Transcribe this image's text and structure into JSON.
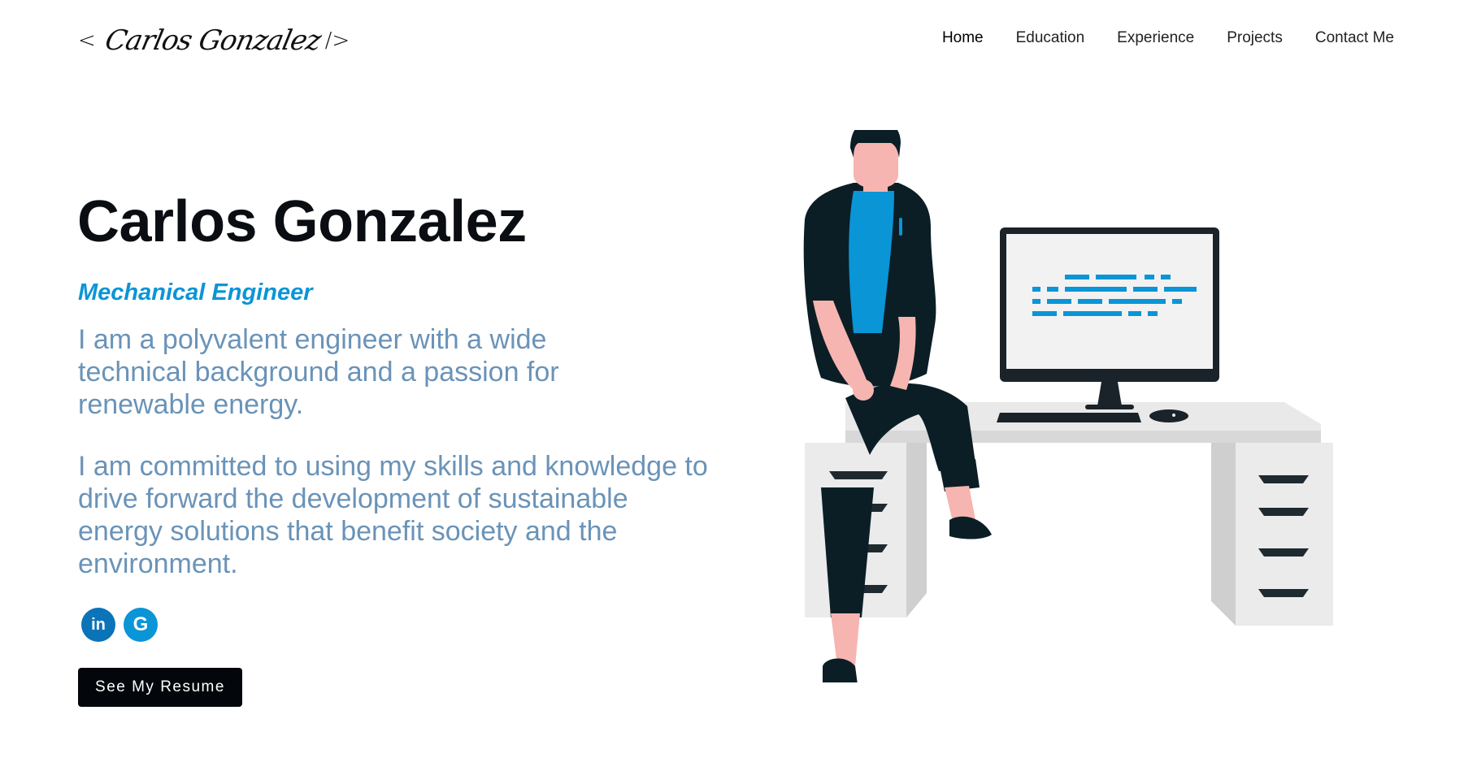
{
  "header": {
    "logo": {
      "open": "<",
      "signature": "Carlos Gonzalez",
      "close": "/>"
    },
    "nav": [
      {
        "label": "Home",
        "active": true
      },
      {
        "label": "Education",
        "active": false
      },
      {
        "label": "Experience",
        "active": false
      },
      {
        "label": "Projects",
        "active": false
      },
      {
        "label": "Contact Me",
        "active": false
      }
    ]
  },
  "hero": {
    "name": "Carlos Gonzalez",
    "role": "Mechanical Engineer",
    "paragraph1": "I am a polyvalent engineer with a wide technical background and a passion for renewable energy.",
    "paragraph2": "I am committed to using my skills and knowledge to drive forward the development of sustainable energy solutions that benefit society and the environment.",
    "socials": [
      {
        "label": "in",
        "icon": "linkedin-icon"
      },
      {
        "label": "G",
        "icon": "google-icon"
      }
    ],
    "resume_button": "See My Resume"
  },
  "colors": {
    "accent": "#0a95d6",
    "text_dark": "#0a0d12",
    "paragraph": "#6a93b8",
    "button_bg": "#03070b"
  }
}
